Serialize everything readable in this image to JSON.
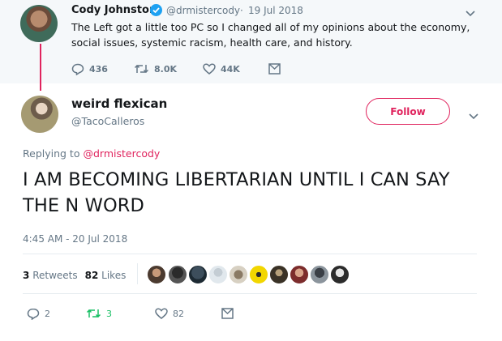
{
  "parent_tweet": {
    "name": "Cody Johnston",
    "handle": "@drmistercody",
    "dot": "·",
    "date": "19 Jul 2018",
    "text": "The Left got a little too PC so I changed all of my opinions about the economy, social issues, systemic racism, health care, and history.",
    "actions": {
      "replies": "436",
      "retweets": "8.0K",
      "likes": "44K"
    }
  },
  "main_tweet": {
    "name": "weird flexican",
    "handle": "@TacoCalleros",
    "follow_label": "Follow",
    "reply_prefix": "Replying to",
    "reply_mention": "@drmistercody",
    "text": "I AM BECOMING LIBERTARIAN UNTIL I CAN SAY THE N WORD",
    "timestamp": "4:45 AM - 20 Jul 2018",
    "stats": {
      "retweets_count": "3",
      "retweets_label": "Retweets",
      "likes_count": "82",
      "likes_label": "Likes"
    },
    "actions": {
      "replies": "2",
      "retweets": "3",
      "likes": "82"
    }
  },
  "colors": {
    "accent": "#e0245e",
    "muted": "#657786",
    "retweet_green": "#17bf63",
    "verified": "#1da1f2"
  },
  "icons": [
    "verified-icon",
    "chevron-down-icon",
    "reply-icon",
    "retweet-icon",
    "like-icon",
    "dm-icon"
  ]
}
